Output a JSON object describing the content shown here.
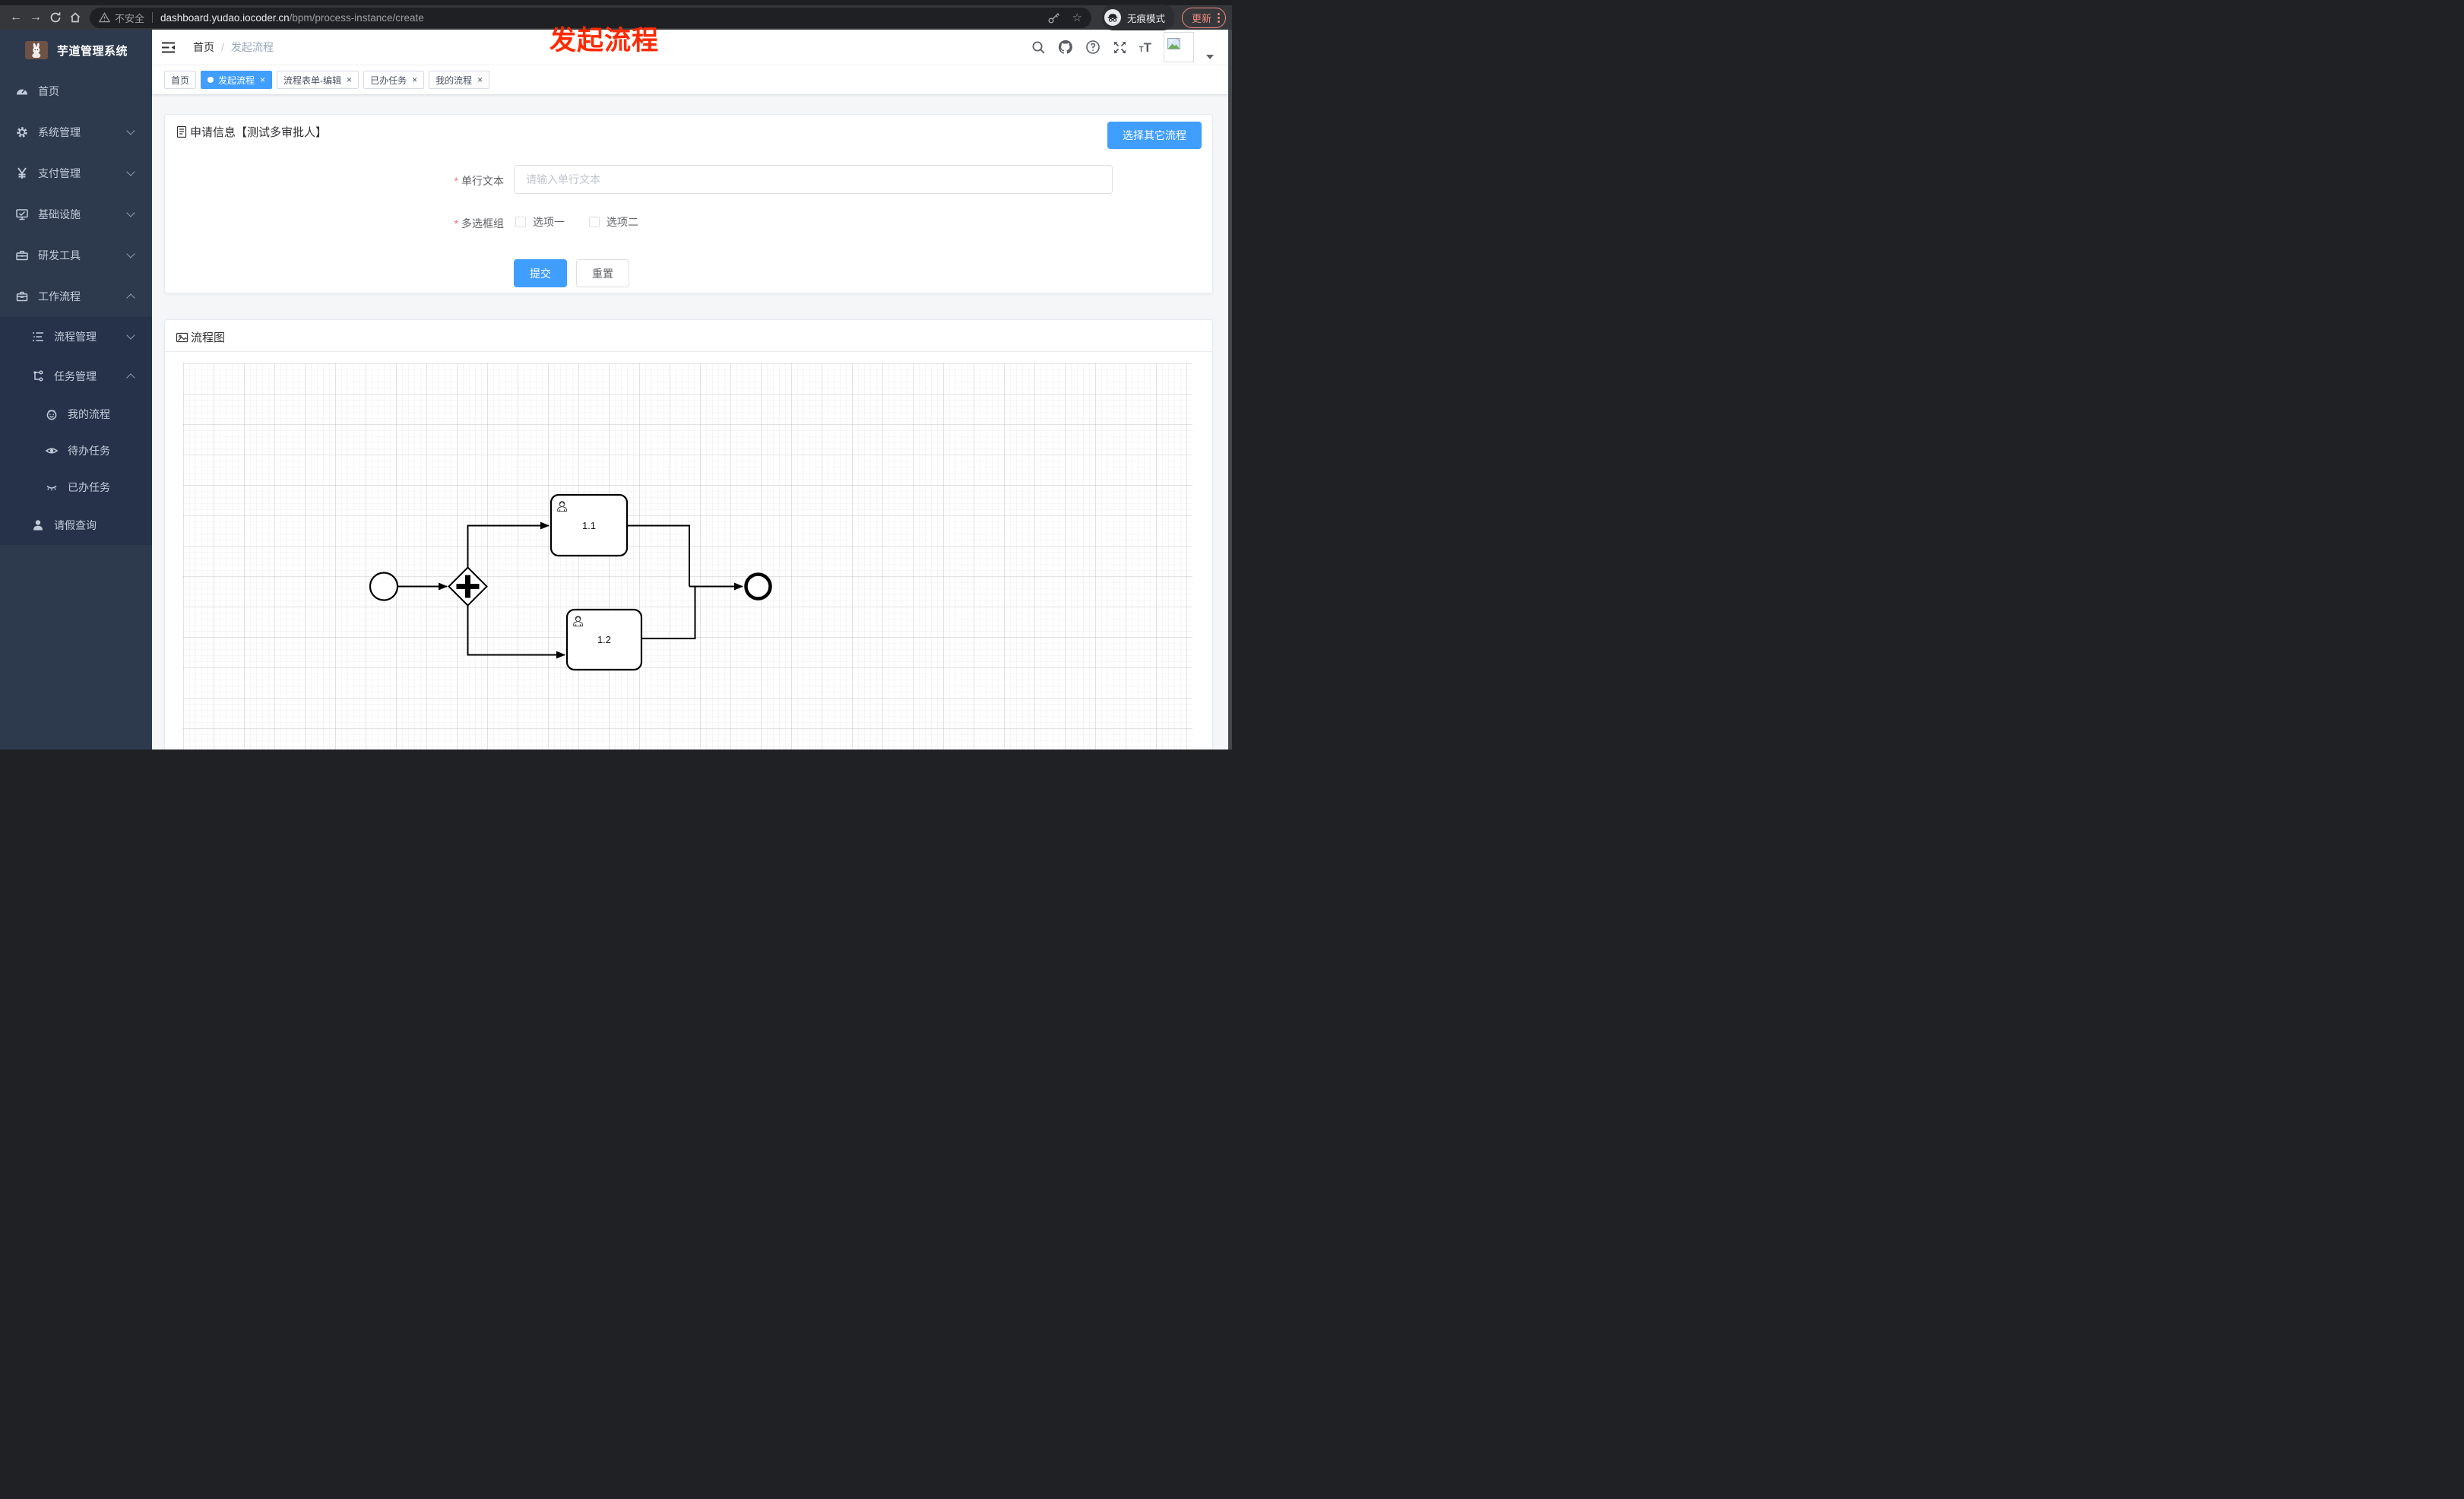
{
  "browser": {
    "security_label": "不安全",
    "url_host": "dashboard.yudao.iocoder.cn",
    "url_path": "/bpm/process-instance/create",
    "incognito_label": "无痕模式",
    "update_label": "更新"
  },
  "annotation": {
    "text": "发起流程",
    "color": "#ff2a00"
  },
  "sidebar": {
    "app_title": "芋道管理系统",
    "items": [
      {
        "label": "首页"
      },
      {
        "label": "系统管理"
      },
      {
        "label": "支付管理"
      },
      {
        "label": "基础设施"
      },
      {
        "label": "研发工具"
      },
      {
        "label": "工作流程"
      },
      {
        "label": "流程管理"
      },
      {
        "label": "任务管理"
      },
      {
        "label": "我的流程"
      },
      {
        "label": "待办任务"
      },
      {
        "label": "已办任务"
      },
      {
        "label": "请假查询"
      }
    ]
  },
  "header": {
    "breadcrumb_home": "首页",
    "breadcrumb_separator": "/",
    "breadcrumb_current": "发起流程"
  },
  "tabbar": {
    "close_glyph": "×",
    "tabs": [
      {
        "label": "首页"
      },
      {
        "label": "发起流程"
      },
      {
        "label": "流程表单-编辑"
      },
      {
        "label": "已办任务"
      },
      {
        "label": "我的流程"
      }
    ]
  },
  "form_card": {
    "title": "申请信息【测试多审批人】",
    "choose_other_button": "选择其它流程",
    "required_mark": "*",
    "text_field_label": "单行文本",
    "text_field_placeholder": "请输入单行文本",
    "checkbox_group_label": "多选框组",
    "checkbox_option_1": "选项一",
    "checkbox_option_2": "选项二",
    "submit_button": "提交",
    "reset_button": "重置"
  },
  "diagram_card": {
    "title": "流程图",
    "task_1_label": "1.1",
    "task_2_label": "1.2"
  },
  "colors": {
    "primary": "#409eff",
    "annotation": "#ff2a00",
    "update_button": "#f28b82",
    "sidebar_bg": "#2d3a4e"
  }
}
